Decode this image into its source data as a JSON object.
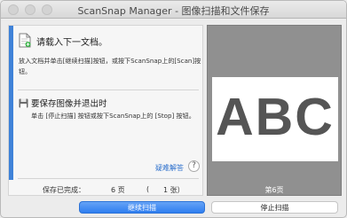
{
  "window": {
    "title": "ScanSnap Manager - 图像扫描和文件保存"
  },
  "instructions": {
    "step_title": "请载入下一文档。",
    "step_desc": "放入文档并单击[继续扫描]按钮，或按下ScanSnap上的[Scan]按钮。",
    "save_title": "要保存图像并退出时",
    "save_desc": "单击 [停止扫描] 按钮或按下ScanSnap上的 [Stop] 按钮。"
  },
  "help": {
    "link_label": "疑难解答",
    "icon_label": "?"
  },
  "status": {
    "saved_label": "保存已完成：",
    "pages": "6 页",
    "open_paren": "(",
    "sheets": "1 张）"
  },
  "preview": {
    "image_text": "ABC",
    "page_label": "第6页"
  },
  "buttons": {
    "continue_label": "继续扫描",
    "stop_label": "停止扫描"
  },
  "colors": {
    "accent": "#3f82d8",
    "primary_button": "#2f7ef0",
    "link": "#2b6fcc"
  },
  "icons": {
    "document": "document-plus-icon",
    "save": "floppy-disk-icon",
    "help": "question-circle-icon"
  }
}
